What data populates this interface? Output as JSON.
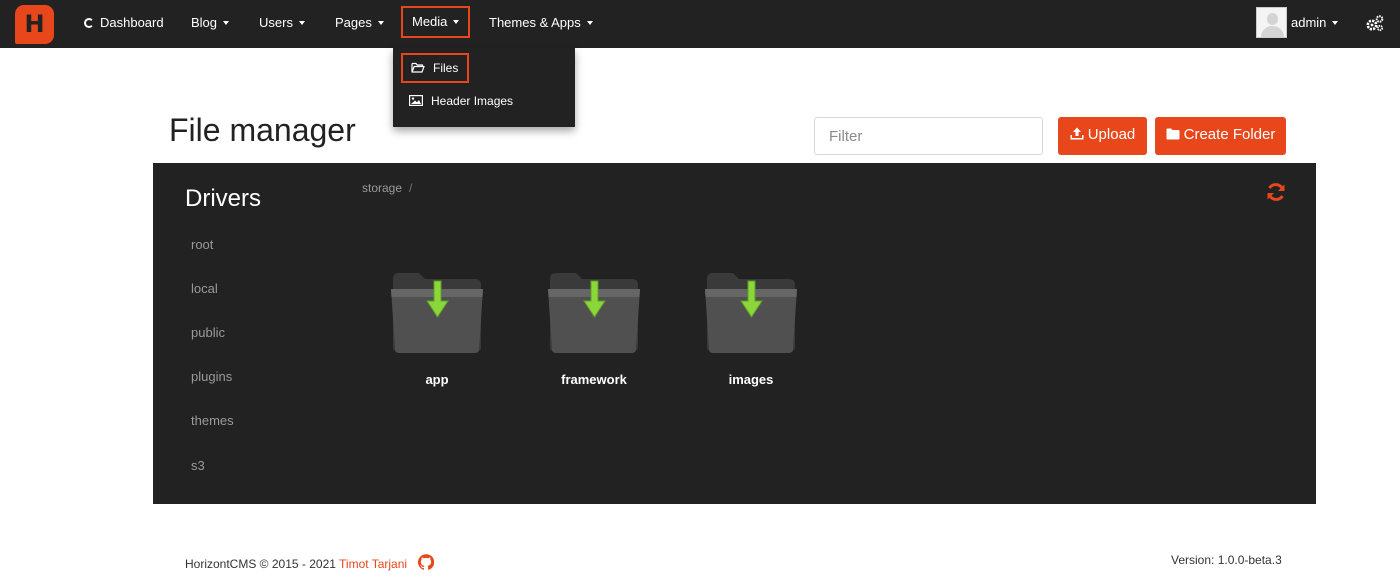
{
  "brand": {
    "logo_letter": "H",
    "accent": "#e8471c"
  },
  "nav": {
    "dashboard": "Dashboard",
    "blog": "Blog",
    "users": "Users",
    "pages": "Pages",
    "media": "Media",
    "themes": "Themes & Apps",
    "user_name": "admin"
  },
  "media_menu": {
    "files": "Files",
    "header_images": "Header Images"
  },
  "page": {
    "title": "File manager",
    "filter_placeholder": "Filter",
    "upload": "Upload",
    "create_folder": "Create Folder"
  },
  "drivers": {
    "title": "Drivers",
    "items": [
      "root",
      "local",
      "public",
      "plugins",
      "themes",
      "s3"
    ]
  },
  "breadcrumb": {
    "root": "storage",
    "separator": "/"
  },
  "folders": [
    "app",
    "framework",
    "images"
  ],
  "footer": {
    "copyright": "HorizontCMS © 2015 - 2021",
    "author": "Timot Tarjani",
    "version": "Version: 1.0.0-beta.3"
  }
}
